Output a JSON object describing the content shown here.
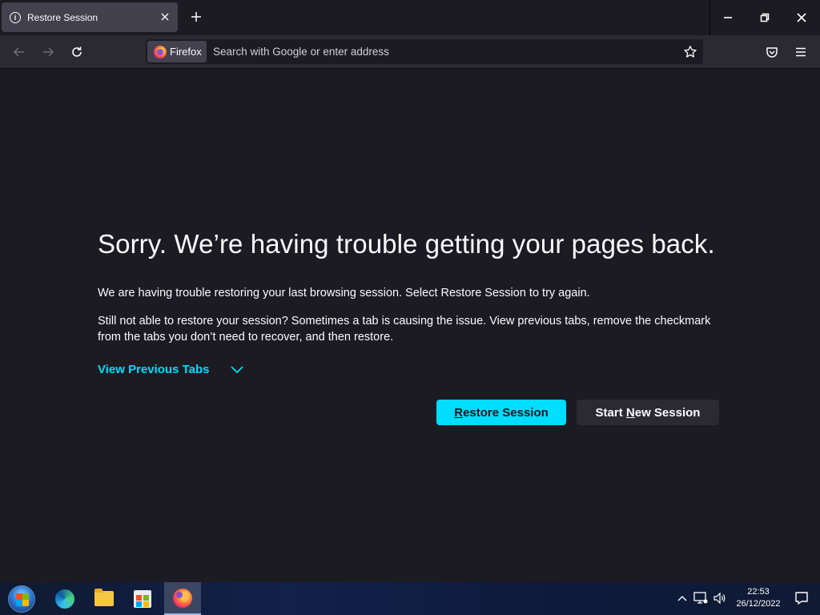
{
  "tab": {
    "title": "Restore Session",
    "info_icon": "info-icon",
    "close_icon": "close-icon"
  },
  "new_tab_icon": "plus-icon",
  "window_controls": [
    "minimize-icon",
    "restore-icon",
    "close-icon"
  ],
  "navbar": {
    "back_icon": "arrow-left-icon",
    "forward_icon": "arrow-right-icon",
    "reload_icon": "reload-icon",
    "identity_label": "Firefox",
    "url_placeholder": "Search with Google or enter address",
    "url_value": "",
    "bookmark_icon": "star-icon",
    "pocket_icon": "pocket-icon",
    "menu_icon": "hamburger-menu-icon"
  },
  "content": {
    "title": "Sorry. We’re having trouble getting your pages back.",
    "para1": "We are having trouble restoring your last browsing session. Select Restore Session to try again.",
    "para2": "Still not able to restore your session? Sometimes a tab is causing the issue. View previous tabs, remove the checkmark from the tabs you don’t need to recover, and then restore.",
    "view_tabs_label": "View Previous Tabs",
    "restore_button": {
      "access_key": "R",
      "rest": "estore Session"
    },
    "new_session_button": {
      "before": "Start ",
      "access_key": "N",
      "after": "ew Session"
    }
  },
  "colors": {
    "accent": "#00ddff",
    "background": "#1c1b22",
    "toolbar": "#2b2a33",
    "tab_selected": "#42414d"
  },
  "taskbar": {
    "items": [
      "start-orb-icon",
      "edge-icon",
      "file-explorer-icon",
      "store-icon",
      "firefox-icon"
    ],
    "active_item": "firefox-icon",
    "tray_icons": [
      "chevron-up-icon",
      "network-icon",
      "volume-icon",
      "notifications-icon"
    ],
    "time": "22:53",
    "date": "26/12/2022"
  }
}
